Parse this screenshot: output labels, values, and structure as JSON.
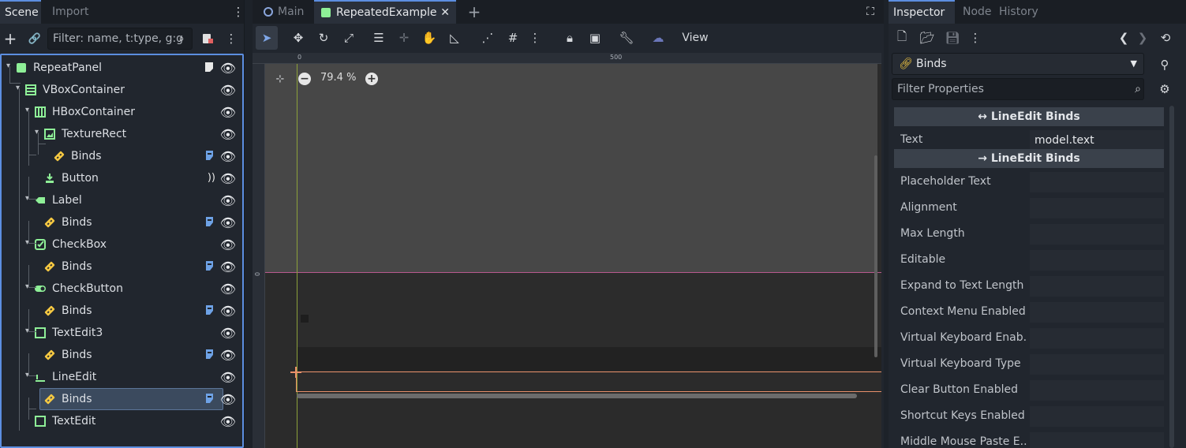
{
  "left_panel": {
    "tabs": [
      "Scene",
      "Import"
    ],
    "filter_placeholder": "Filter: name, t:type, g:g",
    "tree": [
      {
        "label": "RepeatPanel",
        "icon": "panel-icon",
        "indent": 0,
        "arrow": true,
        "extra": "script-icon"
      },
      {
        "label": "VBoxContainer",
        "icon": "vbox-icon",
        "indent": 1,
        "arrow": true
      },
      {
        "label": "HBoxContainer",
        "icon": "hbox-icon",
        "indent": 2,
        "arrow": true
      },
      {
        "label": "TextureRect",
        "icon": "texture-rect-icon",
        "indent": 3,
        "arrow": true
      },
      {
        "label": "Binds",
        "icon": "link-icon",
        "indent": 4,
        "extra": "binds-script-icon"
      },
      {
        "label": "Button",
        "icon": "button-icon",
        "indent": 3,
        "extra": "signal-icon"
      },
      {
        "label": "Label",
        "icon": "label-icon",
        "indent": 2,
        "arrow": true
      },
      {
        "label": "Binds",
        "icon": "link-icon",
        "indent": 3,
        "extra": "binds-script-icon"
      },
      {
        "label": "CheckBox",
        "icon": "checkbox-icon",
        "indent": 2,
        "arrow": true
      },
      {
        "label": "Binds",
        "icon": "link-icon",
        "indent": 3,
        "extra": "binds-script-icon"
      },
      {
        "label": "CheckButton",
        "icon": "checkbutton-icon",
        "indent": 2,
        "arrow": true
      },
      {
        "label": "Binds",
        "icon": "link-icon",
        "indent": 3,
        "extra": "binds-script-icon"
      },
      {
        "label": "TextEdit3",
        "icon": "textedit-icon",
        "indent": 2,
        "arrow": true
      },
      {
        "label": "Binds",
        "icon": "link-icon",
        "indent": 3,
        "extra": "binds-script-icon"
      },
      {
        "label": "LineEdit",
        "icon": "lineedit-icon",
        "indent": 2,
        "arrow": true
      },
      {
        "label": "Binds",
        "icon": "link-icon",
        "indent": 3,
        "extra": "binds-script-icon",
        "selected": true
      },
      {
        "label": "TextEdit",
        "icon": "textedit-icon",
        "indent": 2
      }
    ]
  },
  "center": {
    "tabs": [
      {
        "label": "Main",
        "active": false
      },
      {
        "label": "RepeatedExample",
        "active": true
      }
    ],
    "toolbar_view_label": "View",
    "zoom_label": "79.4 %",
    "ruler_labels": {
      "zero": "0",
      "five_hundred": "500",
      "vertical_zero": "0"
    }
  },
  "inspector": {
    "tabs": [
      "Inspector",
      "Node",
      "History"
    ],
    "object_name": "Binds",
    "filter_placeholder": "Filter Properties",
    "sections": [
      {
        "title": "↔ LineEdit Binds",
        "props": [
          {
            "label": "Text",
            "value": "model.text"
          }
        ]
      },
      {
        "title": "→ LineEdit Binds",
        "props": [
          {
            "label": "Placeholder Text",
            "value": ""
          },
          {
            "label": "Alignment",
            "value": ""
          },
          {
            "label": "Max Length",
            "value": ""
          },
          {
            "label": "Editable",
            "value": ""
          },
          {
            "label": "Expand to Text Length",
            "value": ""
          },
          {
            "label": "Context Menu Enabled",
            "value": ""
          },
          {
            "label": "Virtual Keyboard Enab...",
            "value": ""
          },
          {
            "label": "Virtual Keyboard Type",
            "value": ""
          },
          {
            "label": "Clear Button Enabled",
            "value": ""
          },
          {
            "label": "Shortcut Keys Enabled",
            "value": ""
          },
          {
            "label": "Middle Mouse Paste E...",
            "value": ""
          }
        ]
      }
    ]
  },
  "colors": {
    "accent": "#5c8ee0",
    "node_green": "#8eef97",
    "link_yellow": "#f5c842",
    "script_blue": "#6ea2e6"
  }
}
